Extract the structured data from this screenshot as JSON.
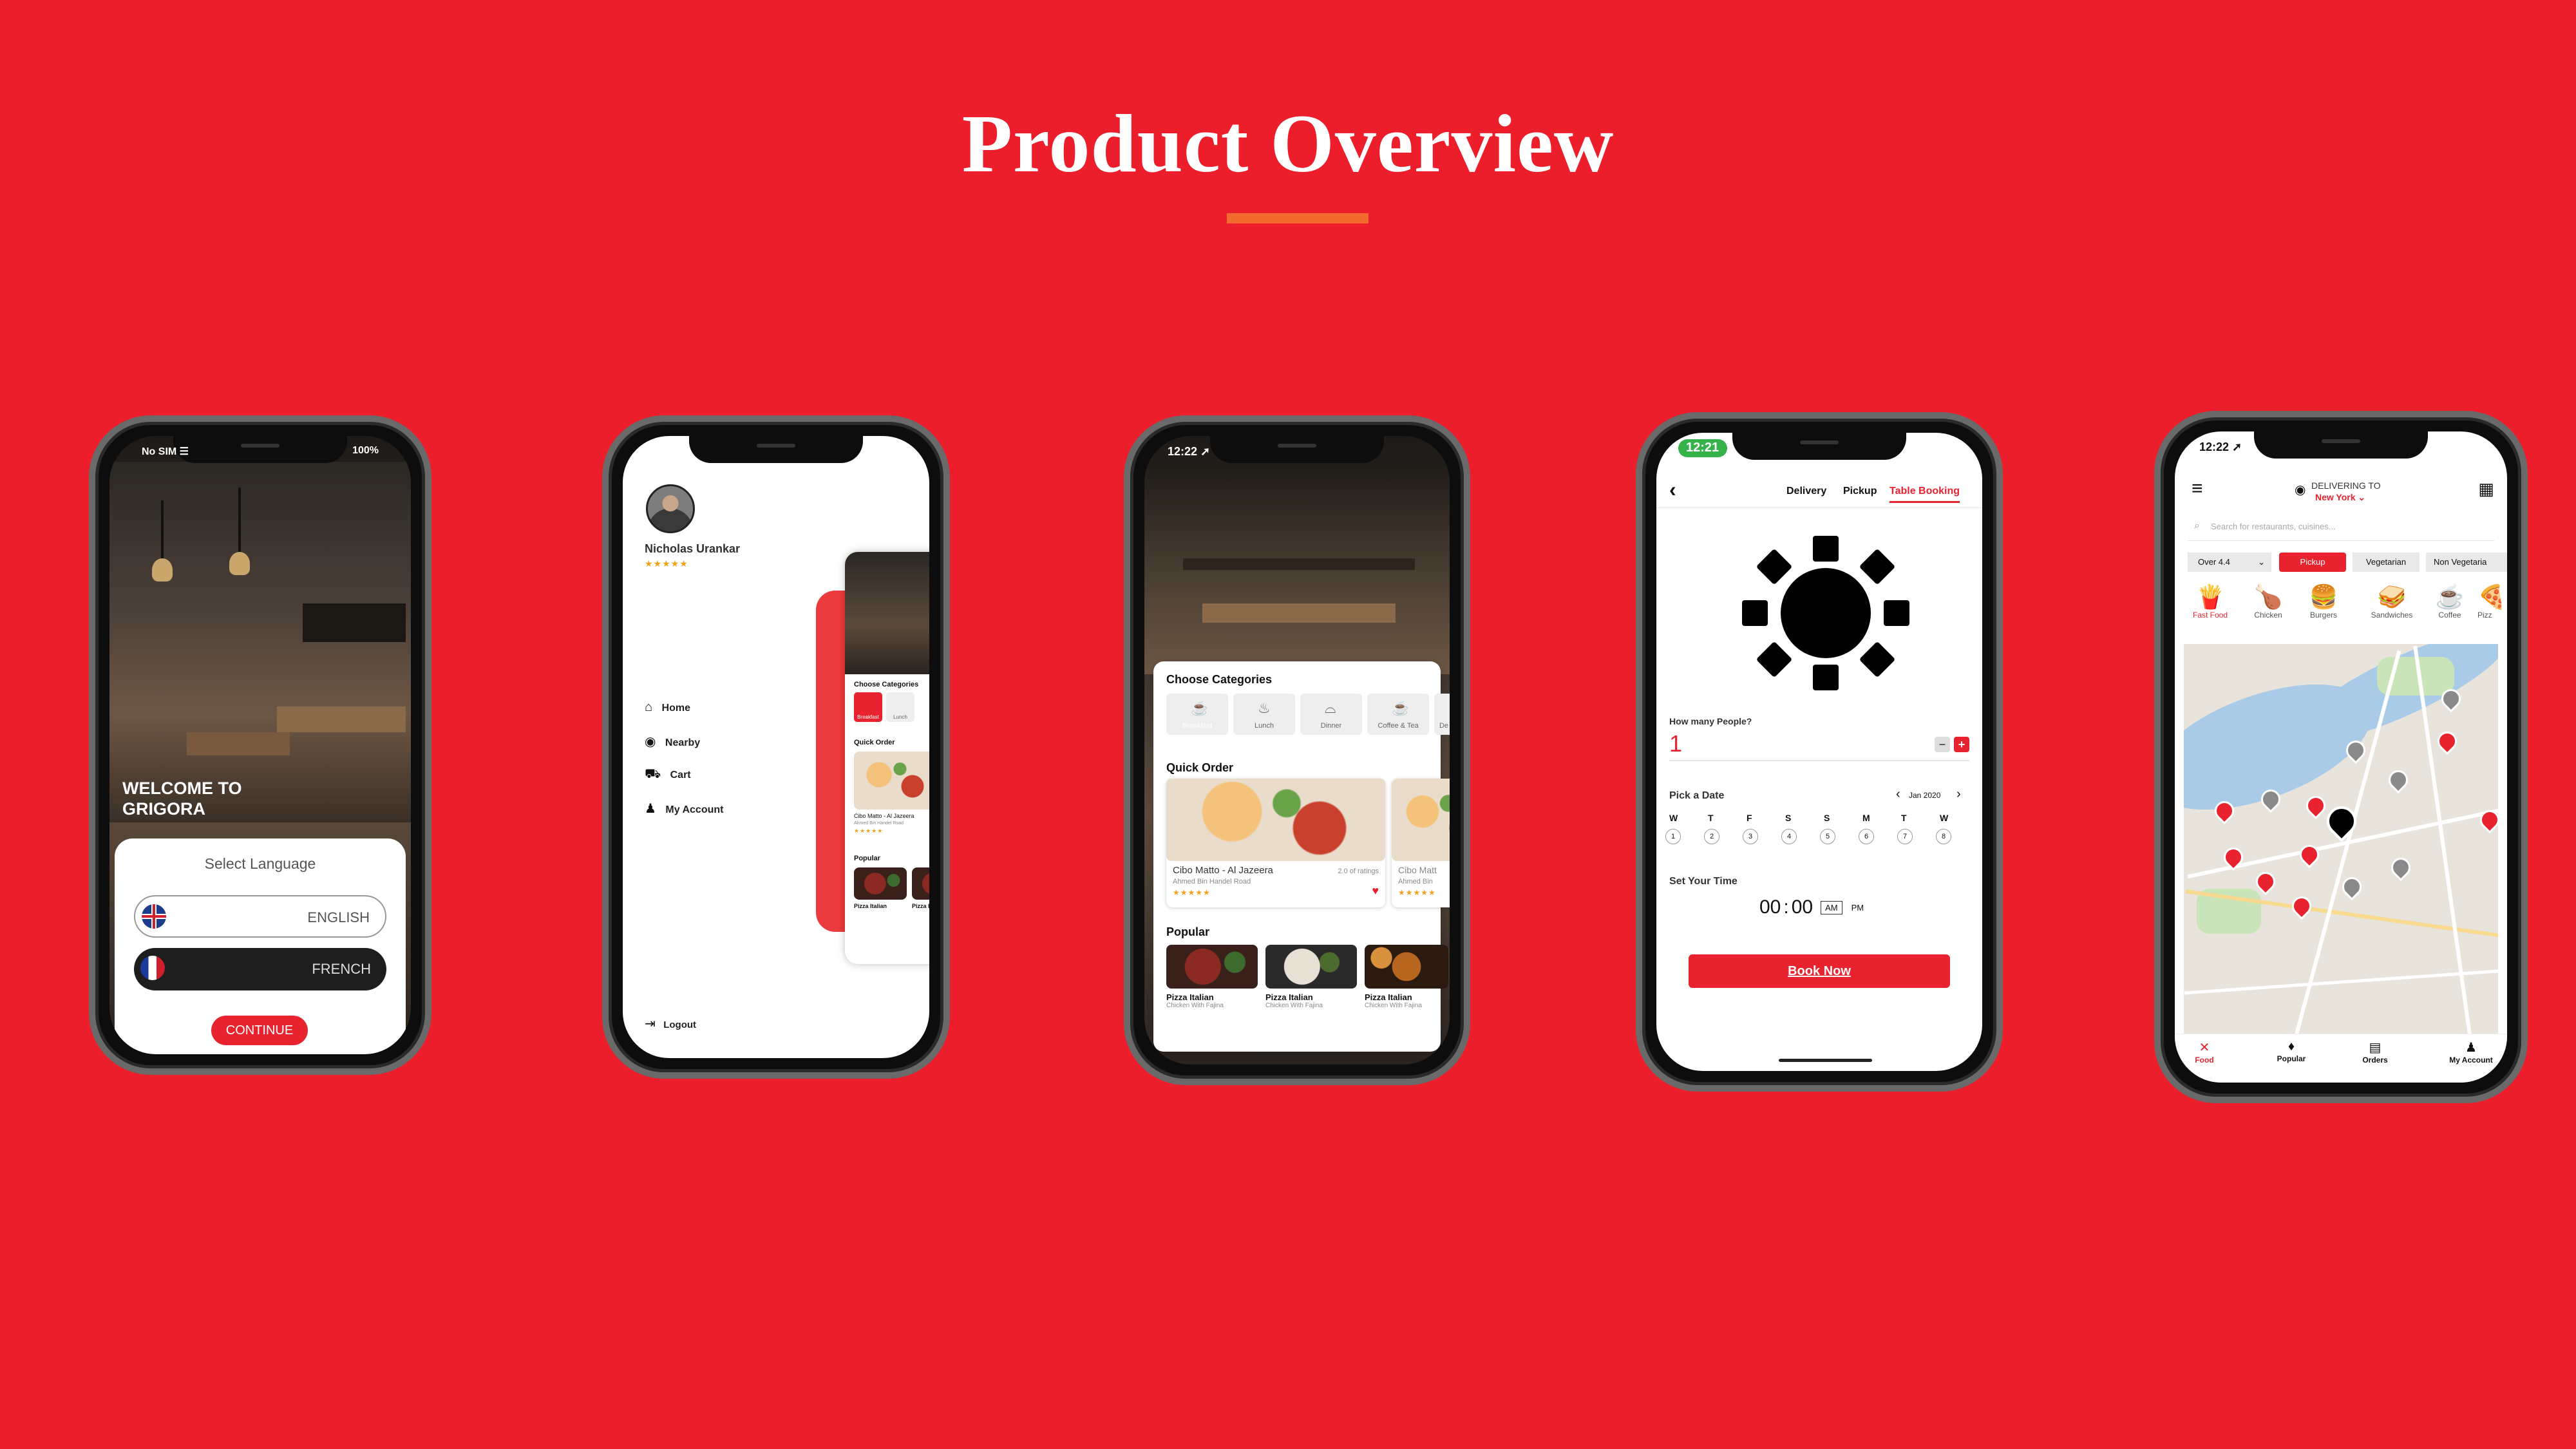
{
  "page": {
    "title": "Product Overview",
    "accent_underline": "#f26a2e",
    "background": "#ec1e2c"
  },
  "phone1": {
    "status_carrier": "No SIM ☰",
    "status_battery": "100%",
    "welcome_line1": "WELCOME TO",
    "welcome_line2": "GRIGORA",
    "select_language": "Select Language",
    "english": "ENGLISH",
    "french": "FRENCH",
    "continue": "CONTINUE"
  },
  "phone2": {
    "user_name": "Nicholas Urankar",
    "stars": "★★★★★",
    "menu": [
      "Home",
      "Nearby",
      "Cart",
      "My Account"
    ],
    "logout": "Logout",
    "preview_choose_categories": "Choose Categories",
    "preview_breakfast": "Breakfast",
    "preview_lunch": "Lunch",
    "preview_quick_order": "Quick Order",
    "preview_item": "Cibo Matto - Al Jazeera",
    "preview_item_sub": "Ahmed Bin Handel Road",
    "preview_stars": "★★★★★",
    "preview_popular": "Popular",
    "preview_pop1": "Pizza Italian",
    "preview_pop2": "Pizza Ita"
  },
  "phone3": {
    "time": "12:22 ➚",
    "choose_categories": "Choose Categories",
    "categories": [
      "Breakfast",
      "Lunch",
      "Dinner",
      "Coffee & Tea",
      "De"
    ],
    "quick_order": "Quick Order",
    "item_name": "Cibo Matto - Al Jazeera",
    "item_ratings": "2.0 of ratings",
    "item_address": "Ahmed Bin Handel Road",
    "item_stars": "★★★★★",
    "item2_name": "Cibo Matt",
    "item2_address": "Ahmed Bin",
    "popular": "Popular",
    "popular_items": [
      {
        "name": "Pizza Italian",
        "sub": "Chicken With Fajina"
      },
      {
        "name": "Pizza Italian",
        "sub": "Chicken With Fajina"
      },
      {
        "name": "Pizza Italian",
        "sub": "Chicken With Fajina"
      }
    ]
  },
  "phone4": {
    "time": "12:21",
    "tabs": [
      "Delivery",
      "Pickup",
      "Table Booking"
    ],
    "how_many_people": "How many People?",
    "people_count": "1",
    "minus": "−",
    "plus": "+",
    "pick_a_date": "Pick a Date",
    "month": "Jan 2020",
    "weekdays": [
      "W",
      "T",
      "F",
      "S",
      "S",
      "M",
      "T",
      "W"
    ],
    "dates": [
      "1",
      "2",
      "3",
      "4",
      "5",
      "6",
      "7",
      "8"
    ],
    "set_your_time": "Set Your Time",
    "hour": "00",
    "minute": "00",
    "am": "AM",
    "pm": "PM",
    "book_now": "Book Now"
  },
  "phone5": {
    "time": "12:22 ➚",
    "delivering_to": "DELIVERING TO",
    "location": "New York",
    "search_placeholder": "Search for restaurants, cuisines...",
    "filters": [
      "Over 4.4",
      "Pickup",
      "Vegetarian",
      "Non Vegetaria"
    ],
    "food_types": [
      "Fast Food",
      "Chicken",
      "Burgers",
      "Sandwiches",
      "Coffee",
      "Pizz"
    ],
    "nav": [
      "Food",
      "Popular",
      "Orders",
      "My Account"
    ]
  }
}
